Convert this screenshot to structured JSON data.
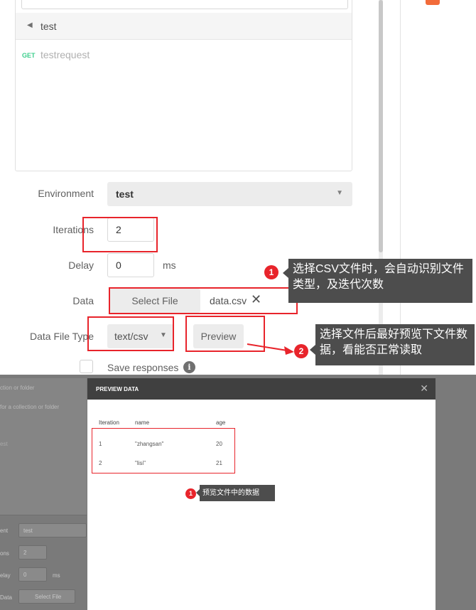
{
  "runner": {
    "folder": {
      "name": "test"
    },
    "request": {
      "method": "GET",
      "name": "testrequest"
    },
    "fields": {
      "environment_label": "Environment",
      "environment_value": "test",
      "iterations_label": "Iterations",
      "iterations_value": "2",
      "delay_label": "Delay",
      "delay_value": "0",
      "delay_unit": "ms",
      "data_label": "Data",
      "select_file_label": "Select File",
      "file_name": "data.csv",
      "data_file_type_label": "Data File Type",
      "data_file_type_value": "text/csv",
      "preview_label": "Preview",
      "save_responses_label": "Save responses"
    }
  },
  "annotations": {
    "note_1_number": "1",
    "note_1_text": "选择CSV文件时，会自动识别文件类型，及迭代次数",
    "note_2_number": "2",
    "note_2_text": "选择文件后最好预览下文件数据，看能否正常读取",
    "modal_note_number": "1",
    "modal_note_text": "预览文件中的数据"
  },
  "background": {
    "text_1": "ction or folder",
    "text_2": "for a collection or folder",
    "text_3": "est",
    "env_label": "ent",
    "env_value": "test",
    "iter_label": "ons",
    "iter_value": "2",
    "delay_label": "elay",
    "delay_value": "0",
    "delay_unit": "ms",
    "data_label": "Data",
    "select_file": "Select File"
  },
  "preview_modal": {
    "title": "PREVIEW DATA",
    "close_icon": "close-icon",
    "columns": [
      "Iteration",
      "name",
      "age"
    ],
    "rows": [
      [
        "1",
        "\"zhangsan\"",
        "20"
      ],
      [
        "2",
        "\"lisi\"",
        "21"
      ]
    ]
  },
  "colors": {
    "annotation_red": "#e8242b",
    "callout_bg": "#4d4d4d",
    "get_method": "#3ecf8e",
    "modal_header": "#404040"
  }
}
